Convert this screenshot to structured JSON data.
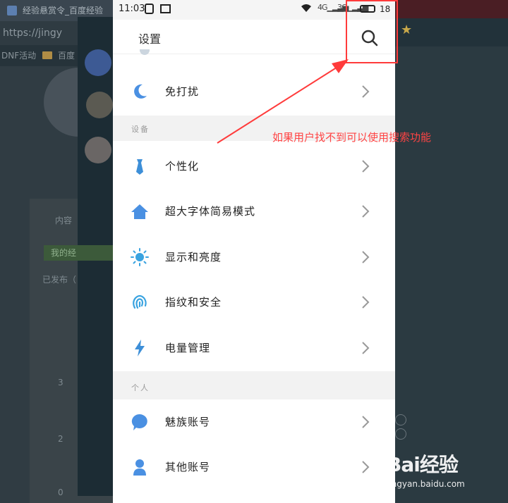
{
  "background_browser": {
    "tab_title": "经验悬赏令_百度经验",
    "address_text": "https://jingy",
    "bookmark_1": "DNF活动",
    "bookmark_2": "百度",
    "side_text_1": "内容",
    "side_text_2": "我的经",
    "side_text_3": "已发布（",
    "count_1": "3",
    "count_2": "2",
    "count_3": "0"
  },
  "statusbar": {
    "time": "11:03",
    "net1": "4G",
    "net2": "3G",
    "battery": "18"
  },
  "header": {
    "title": "设置",
    "search_icon": "search-icon"
  },
  "rows_top": [
    {
      "label": "免打扰",
      "icon": "moon-icon",
      "color": "#4a90e2"
    }
  ],
  "sections": [
    {
      "label": "设备"
    },
    {
      "label": "个人"
    }
  ],
  "rows_device": [
    {
      "label": "个性化",
      "icon": "tie-icon",
      "color": "#3d8fd8"
    },
    {
      "label": "超大字体简易模式",
      "icon": "home-icon",
      "color": "#4a90e2"
    },
    {
      "label": "显示和亮度",
      "icon": "sun-icon",
      "color": "#3aa3e0"
    },
    {
      "label": "指纹和安全",
      "icon": "fingerprint-icon",
      "color": "#3aa3e0"
    },
    {
      "label": "电量管理",
      "icon": "lightning-icon",
      "color": "#3d8fd8"
    }
  ],
  "rows_personal": [
    {
      "label": "魅族账号",
      "icon": "chat-bubble-icon",
      "color": "#4a90e2"
    },
    {
      "label": "其他账号",
      "icon": "user-icon",
      "color": "#4a90e2"
    }
  ],
  "annotation": {
    "text": "如果用户找不到可以使用搜索功能",
    "color": "#ff3b3b"
  },
  "watermark": {
    "logo": "Bai经验",
    "url": "jingyan.baidu.com"
  }
}
